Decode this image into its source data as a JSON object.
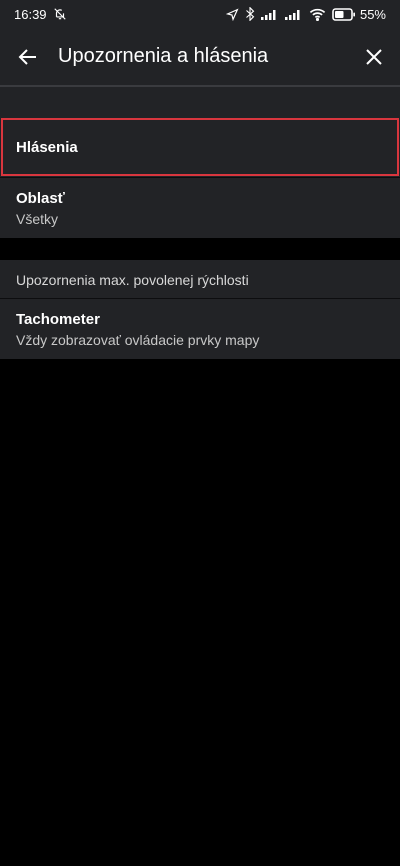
{
  "status_bar": {
    "time": "16:39",
    "battery": "55%",
    "icons": [
      "bell-off-icon",
      "location-arrow-icon",
      "bluetooth-icon",
      "signal-icon",
      "signal-icon",
      "wifi-icon",
      "battery-icon"
    ]
  },
  "header": {
    "title": "Upozornenia a hlásenia",
    "back_icon": "arrow-left-icon",
    "close_icon": "close-icon"
  },
  "settings": {
    "reports_label": "Hlásenia",
    "area_label": "Oblasť",
    "area_value": "Všetky",
    "speed_section_header": "Upozornenia max. povolenej rýchlosti",
    "speedometer_label": "Tachometer",
    "speedometer_value": "Vždy zobrazovať ovládacie prvky mapy"
  },
  "colors": {
    "background": "#000000",
    "surface": "#222326",
    "highlight_border": "#d9363e"
  }
}
